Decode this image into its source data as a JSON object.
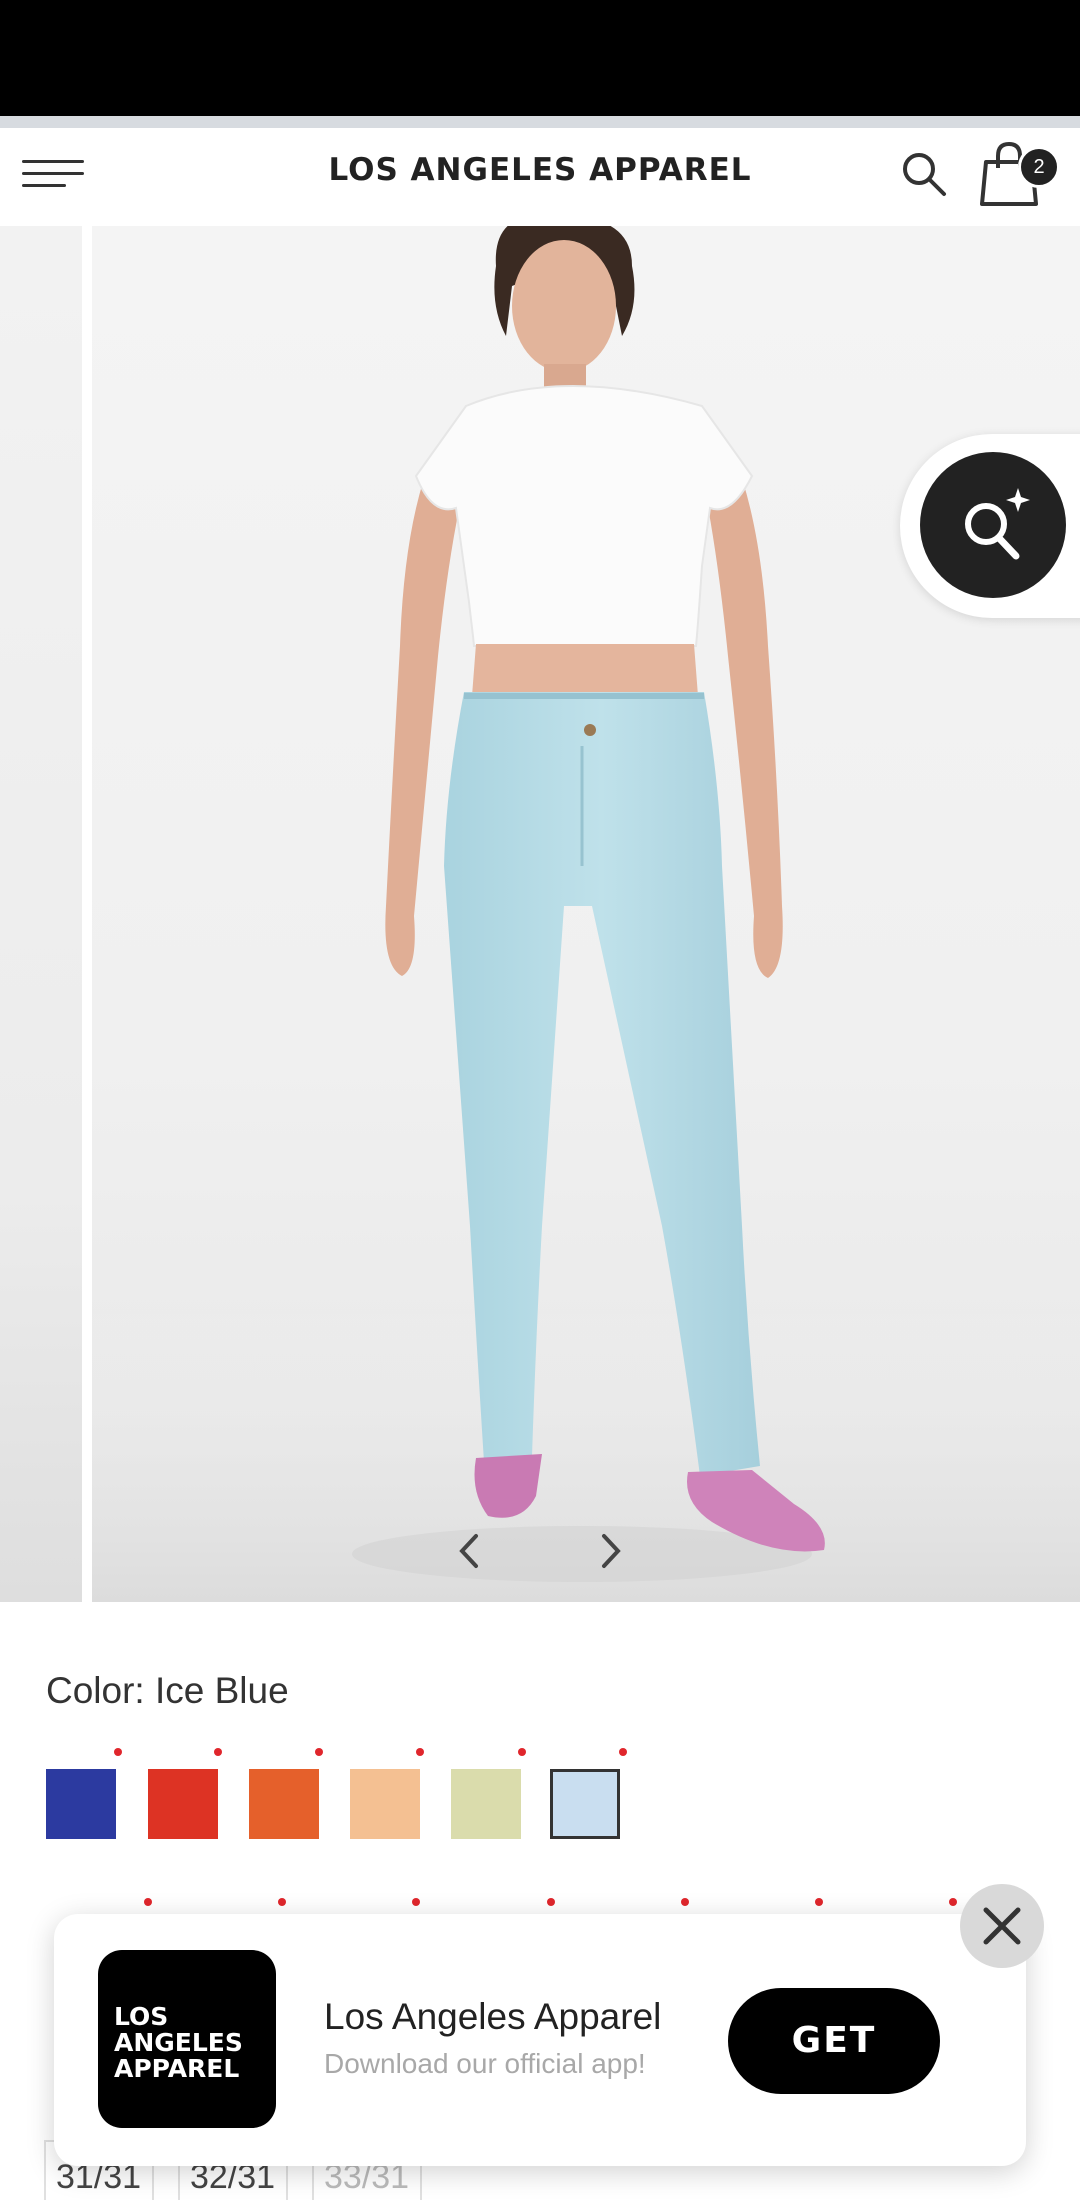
{
  "header": {
    "logo_text": "LOS ANGELES APPAREL",
    "cart_count": "2",
    "icons": [
      "menu-icon",
      "search-icon",
      "shopping-bag-icon"
    ]
  },
  "gallery": {
    "product_image": "model wearing ice blue high-waist jeans",
    "zoom_icon": "zoom-sparkle-icon",
    "prev_icon": "chevron-left-icon",
    "next_icon": "chevron-right-icon"
  },
  "product": {
    "color_label": "Color: Ice Blue",
    "swatches": [
      {
        "name": "Navy",
        "hex": "#2c3aa0"
      },
      {
        "name": "Red",
        "hex": "#dd3324"
      },
      {
        "name": "Orange",
        "hex": "#e5602b"
      },
      {
        "name": "Peach",
        "hex": "#f4c092"
      },
      {
        "name": "Sage",
        "hex": "#dadcac"
      },
      {
        "name": "Ice Blue",
        "hex": "#c9def0",
        "selected": true
      }
    ],
    "sizes_visible": [
      "31/31",
      "32/31",
      "33/31"
    ]
  },
  "app_banner": {
    "icon_text": "LOS\nANGELES\nAPPAREL",
    "app_name": "Los Angeles Apparel",
    "subtitle": "Download our official app!",
    "get_label": "GET",
    "close_icon": "close-icon"
  }
}
